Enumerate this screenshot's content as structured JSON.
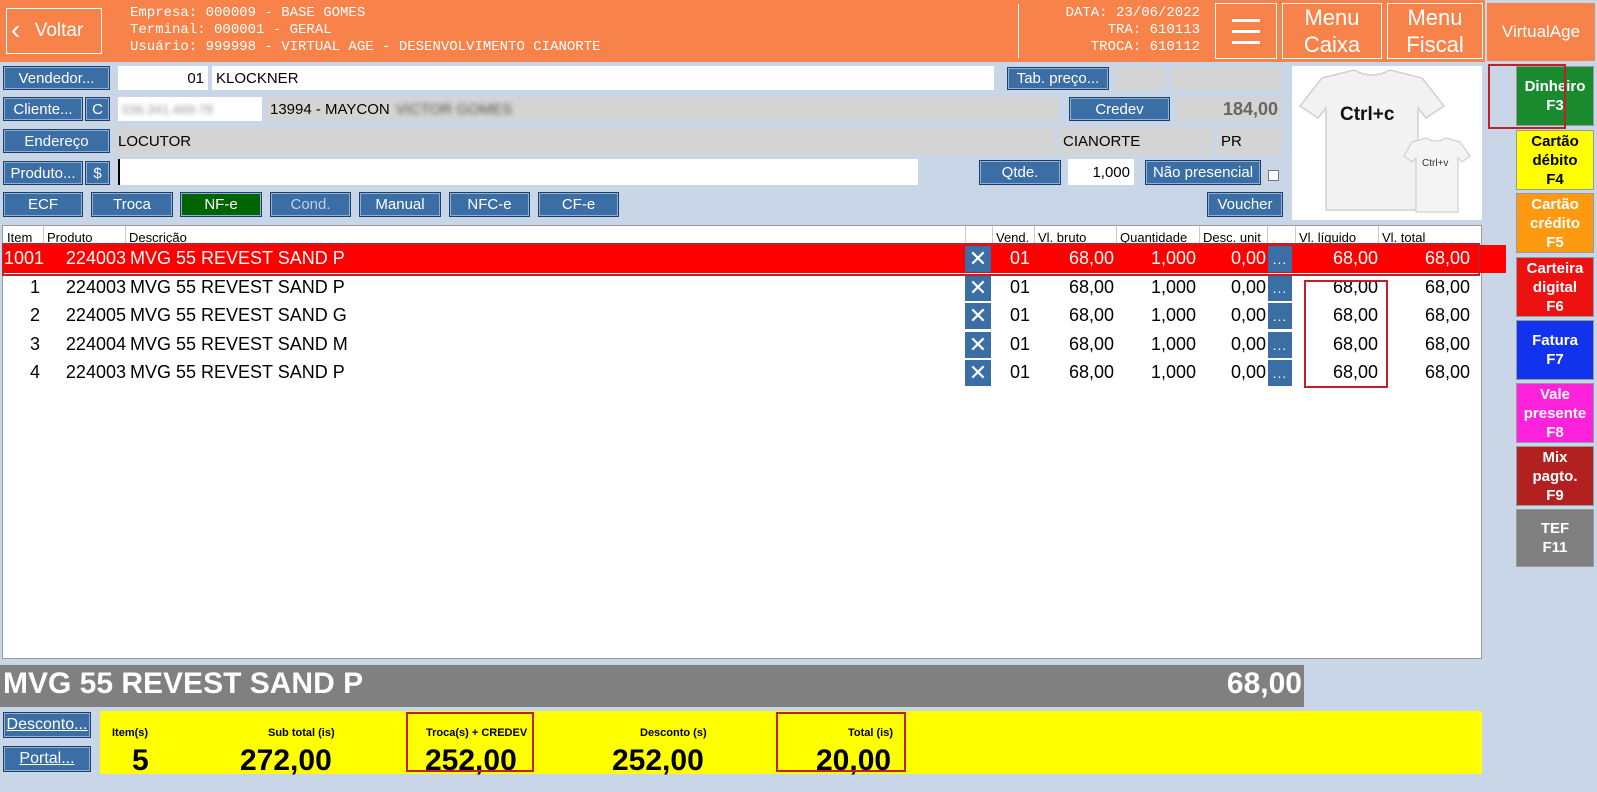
{
  "header": {
    "back_label": "Voltar",
    "empresa": "Empresa: 000009 - BASE GOMES",
    "terminal": "Terminal: 000001 - GERAL",
    "usuario": "Usuário: 999998 - VIRTUAL AGE - DESENVOLVIMENTO CIANORTE",
    "data": "DATA: 23/06/2022",
    "tra": "TRA: 610113",
    "troca": "TROCA: 610112",
    "menu_icon": "hamburger-icon",
    "menu_caixa_1": "Menu",
    "menu_caixa_2": "Caixa",
    "menu_fiscal_1": "Menu",
    "menu_fiscal_2": "Fiscal",
    "brand": "VirtualAge"
  },
  "form": {
    "vendedor_label": "Vendedor...",
    "vendedor_code": "01",
    "vendedor_name": "KLOCKNER",
    "tab_preco_label": "Tab. preço...",
    "cliente_label": "Cliente...",
    "c_label": "C",
    "cliente_doc": "036.341.469-78",
    "cliente_name": "13994 - MAYCON",
    "cliente_surname": "VICTOR GOMES",
    "credev_label": "Credev",
    "credev_value": "184,00",
    "endereco_label": "Endereço",
    "endereco_value": "LOCUTOR",
    "cidade": "CIANORTE",
    "uf": "PR",
    "produto_label": "Produto...",
    "dollar_label": "$",
    "produto_value": "",
    "qtde_label": "Qtde.",
    "qtde_value": "1,000",
    "nao_presencial_label": "Não presencial",
    "product_image_text_1": "Ctrl+c",
    "product_image_text_2": "Ctrl+v"
  },
  "doc_buttons": {
    "ecf": "ECF",
    "troca": "Troca",
    "nfe": "NF-e",
    "cond": "Cond.",
    "manual": "Manual",
    "nfce": "NFC-e",
    "cfe": "CF-e",
    "voucher": "Voucher"
  },
  "table": {
    "columns": {
      "item": "Item",
      "produto": "Produto",
      "descricao": "Descrição",
      "vend": "Vend.",
      "vl_bruto": "Vl. bruto",
      "quantidade": "Quantidade",
      "desc_unit": "Desc. unit",
      "vl_liquido": "Vl. líquido",
      "vl_total": "Vl. total"
    },
    "rows": [
      {
        "item": "1001",
        "produto": "224003",
        "descricao": "MVG 55 REVEST SAND P",
        "vend": "01",
        "vl_bruto": "68,00",
        "quantidade": "1,000",
        "desc_unit": "0,00",
        "vl_liquido": "68,00",
        "vl_total": "68,00"
      },
      {
        "item": "1",
        "produto": "224003",
        "descricao": "MVG 55 REVEST SAND P",
        "vend": "01",
        "vl_bruto": "68,00",
        "quantidade": "1,000",
        "desc_unit": "0,00",
        "vl_liquido": "68,00",
        "vl_total": "68,00"
      },
      {
        "item": "2",
        "produto": "224005",
        "descricao": "MVG 55 REVEST SAND G",
        "vend": "01",
        "vl_bruto": "68,00",
        "quantidade": "1,000",
        "desc_unit": "0,00",
        "vl_liquido": "68,00",
        "vl_total": "68,00"
      },
      {
        "item": "3",
        "produto": "224004",
        "descricao": "MVG 55 REVEST SAND M",
        "vend": "01",
        "vl_bruto": "68,00",
        "quantidade": "1,000",
        "desc_unit": "0,00",
        "vl_liquido": "68,00",
        "vl_total": "68,00"
      },
      {
        "item": "4",
        "produto": "224003",
        "descricao": "MVG 55 REVEST SAND P",
        "vend": "01",
        "vl_bruto": "68,00",
        "quantidade": "1,000",
        "desc_unit": "0,00",
        "vl_liquido": "68,00",
        "vl_total": "68,00"
      }
    ],
    "remove_icon": "close-icon",
    "dots_label": "..."
  },
  "summary": {
    "current_product": "MVG 55 REVEST SAND P",
    "current_price": "68,00"
  },
  "totals": {
    "desconto_label": "Desconto...",
    "portal_label": "Portal...",
    "itens_label": "Item(s)",
    "itens_value": "5",
    "subtotal_label": "Sub total (is)",
    "subtotal_value": "272,00",
    "troca_label": "Troca(s) + CREDEV",
    "troca_value": "252,00",
    "desconto_total_label": "Desconto (s)",
    "desconto_total_value": "252,00",
    "total_label": "Total (is)",
    "total_value": "20,00"
  },
  "payments": [
    {
      "line1": "Dinheiro",
      "line2": "F3",
      "color": "#1a8a2e",
      "text": "#ffffff"
    },
    {
      "line1": "Cartão",
      "line2": "débito",
      "line3": "F4",
      "color": "#ffff00",
      "text": "#000000"
    },
    {
      "line1": "Cartão",
      "line2": "crédito",
      "line3": "F5",
      "color": "#ff9a10",
      "text": "#ffffff"
    },
    {
      "line1": "Carteira",
      "line2": "digital",
      "line3": "F6",
      "color": "#ee1111",
      "text": "#ffffff"
    },
    {
      "line1": "Fatura",
      "line2": "F7",
      "color": "#1133ee",
      "text": "#ffffff"
    },
    {
      "line1": "Vale",
      "line2": "presente",
      "line3": "F8",
      "color": "#ff22dd",
      "text": "#ffffff"
    },
    {
      "line1": "Mix",
      "line2": "pagto.",
      "line3": "F9",
      "color": "#b32020",
      "text": "#ffffff"
    },
    {
      "line1": "TEF",
      "line2": "F11",
      "color": "#808080",
      "text": "#ffffff"
    }
  ],
  "colors": {
    "header_orange": "#f7834a",
    "button_blue": "#3a6ea5",
    "selected_row": "#ff0000",
    "totals_yellow": "#ffff00",
    "nfe_green": "#006400"
  }
}
